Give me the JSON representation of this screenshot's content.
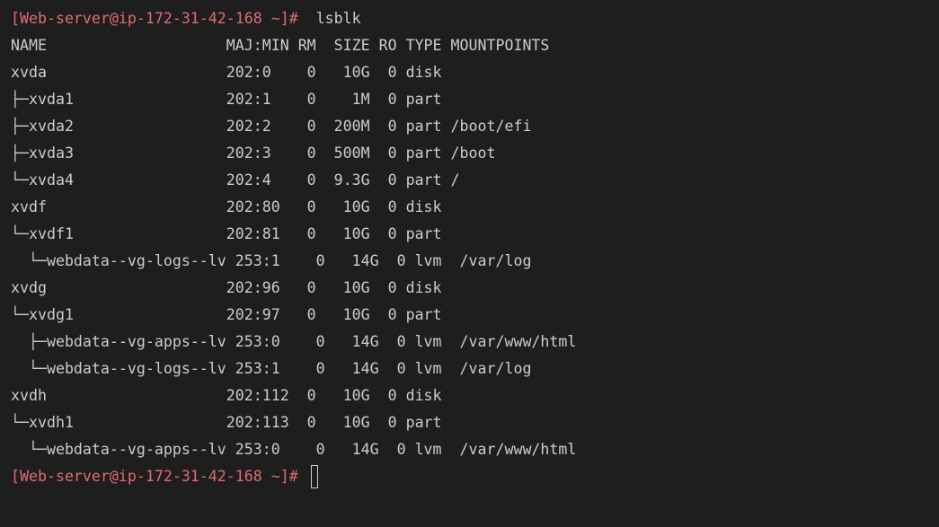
{
  "prompt": {
    "text": "[Web-server@ip-172-31-42-168 ~]#",
    "command": "lsblk"
  },
  "output_lines": [
    "NAME                    MAJ:MIN RM  SIZE RO TYPE MOUNTPOINTS",
    "xvda                    202:0    0   10G  0 disk",
    "├─xvda1                 202:1    0    1M  0 part",
    "├─xvda2                 202:2    0  200M  0 part /boot/efi",
    "├─xvda3                 202:3    0  500M  0 part /boot",
    "└─xvda4                 202:4    0  9.3G  0 part /",
    "xvdf                    202:80   0   10G  0 disk",
    "└─xvdf1                 202:81   0   10G  0 part",
    "  └─webdata--vg-logs--lv 253:1    0   14G  0 lvm  /var/log",
    "xvdg                    202:96   0   10G  0 disk",
    "└─xvdg1                 202:97   0   10G  0 part",
    "  ├─webdata--vg-apps--lv 253:0    0   14G  0 lvm  /var/www/html",
    "  └─webdata--vg-logs--lv 253:1    0   14G  0 lvm  /var/log",
    "xvdh                    202:112  0   10G  0 disk",
    "└─xvdh1                 202:113  0   10G  0 part",
    "  └─webdata--vg-apps--lv 253:0    0   14G  0 lvm  /var/www/html"
  ],
  "final_prompt": {
    "text": "[Web-server@ip-172-31-42-168 ~]#"
  },
  "colors": {
    "background": "#1e1e1e",
    "text": "#cccccc",
    "prompt": "#e06c75"
  }
}
